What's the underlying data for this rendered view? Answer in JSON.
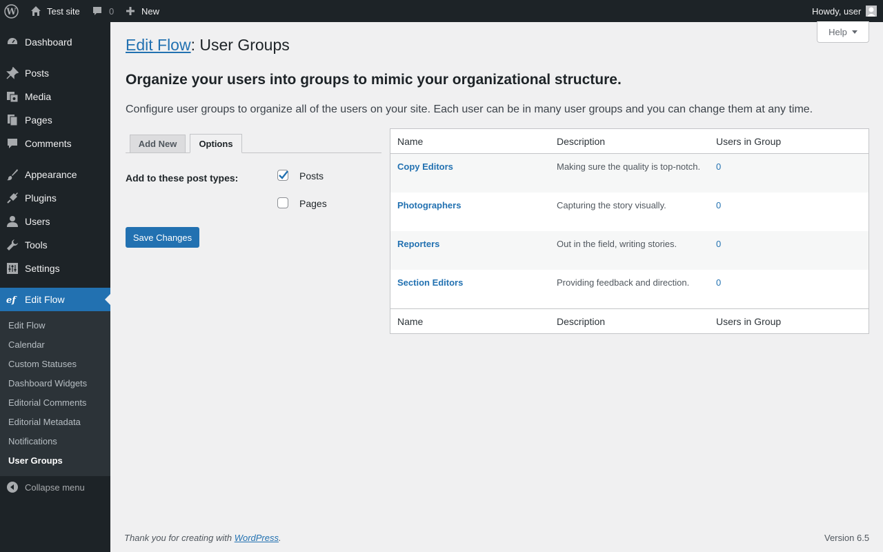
{
  "adminbar": {
    "site_name": "Test site",
    "comments_count": "0",
    "new_label": "New",
    "greeting": "Howdy, user"
  },
  "sidebar": {
    "items": [
      {
        "label": "Dashboard",
        "icon": "dashboard-icon"
      },
      {
        "label": "Posts",
        "icon": "pin-icon"
      },
      {
        "label": "Media",
        "icon": "media-icon"
      },
      {
        "label": "Pages",
        "icon": "pages-icon"
      },
      {
        "label": "Comments",
        "icon": "comment-icon"
      },
      {
        "label": "Appearance",
        "icon": "paintbrush-icon"
      },
      {
        "label": "Plugins",
        "icon": "plug-icon"
      },
      {
        "label": "Users",
        "icon": "user-icon"
      },
      {
        "label": "Tools",
        "icon": "wrench-icon"
      },
      {
        "label": "Settings",
        "icon": "settings-icon"
      },
      {
        "label": "Edit Flow",
        "icon": "edit-flow-icon"
      }
    ],
    "submenu": [
      "Edit Flow",
      "Calendar",
      "Custom Statuses",
      "Dashboard Widgets",
      "Editorial Comments",
      "Editorial Metadata",
      "Notifications",
      "User Groups"
    ],
    "collapse_label": "Collapse menu"
  },
  "help_label": "Help",
  "page": {
    "title_link": "Edit Flow",
    "title_rest": ": User Groups",
    "heading": "Organize your users into groups to mimic your organizational structure.",
    "intro": "Configure user groups to organize all of the users on your site. Each user can be in many user groups and you can change them at any time."
  },
  "tabs": [
    "Add New",
    "Options"
  ],
  "options": {
    "label": "Add to these post types:",
    "checkboxes": [
      {
        "label": "Posts",
        "checked": true
      },
      {
        "label": "Pages",
        "checked": false
      }
    ],
    "save_label": "Save Changes"
  },
  "table": {
    "columns": [
      "Name",
      "Description",
      "Users in Group"
    ],
    "rows": [
      {
        "name": "Copy Editors",
        "description": "Making sure the quality is top-notch.",
        "count": "0"
      },
      {
        "name": "Photographers",
        "description": "Capturing the story visually.",
        "count": "0"
      },
      {
        "name": "Reporters",
        "description": "Out in the field, writing stories.",
        "count": "0"
      },
      {
        "name": "Section Editors",
        "description": "Providing feedback and direction.",
        "count": "0"
      }
    ]
  },
  "footer": {
    "thanks_prefix": "Thank you for creating with ",
    "thanks_link": "WordPress",
    "thanks_suffix": ".",
    "version": "Version 6.5"
  }
}
